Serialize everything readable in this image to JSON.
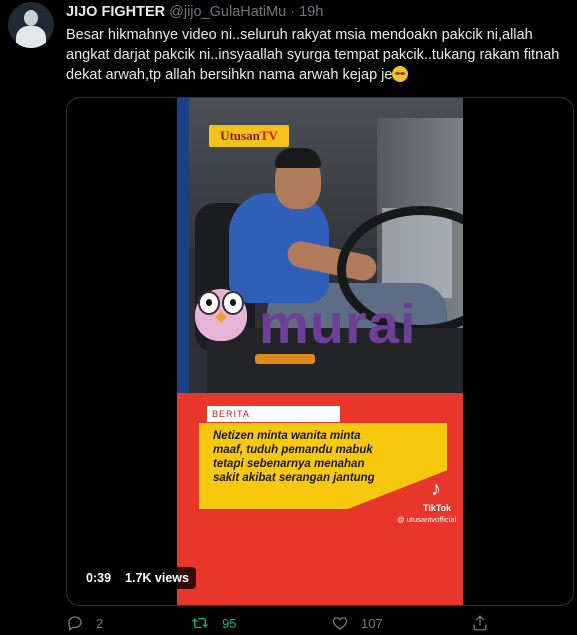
{
  "tweet": {
    "author_name": "JIJO FIGHTER",
    "handle": "@jijo_GulaHatiMu",
    "separator": "·",
    "time": "19h",
    "text": "Besar hikmahnye video ni..seluruh rakyat msia mendoakn pakcik ni,allah angkat darjat pakcik ni..insyaallah syurga tempat pakcik..tukang rakam fitnah dekat arwah,tp allah bersihkn nama arwah kejap je"
  },
  "video": {
    "brand_logo": "Utusan",
    "brand_logo_tv": "TV",
    "watermark": "murai",
    "category": "BERITA",
    "headline": "Netizen minta wanita minta maaf, tuduh pemandu mabuk tetapi sebenarnya menahan sakit akibat serangan jantung",
    "tiktok_icon": "♪",
    "tiktok_label": "TikTok",
    "tiktok_user": "@ utusantvofficial",
    "duration": "0:39",
    "views": "1.7K views"
  },
  "actions": {
    "reply_icon": "reply-icon",
    "reply_count": "2",
    "retweet_icon": "retweet-icon",
    "retweet_count": "95",
    "like_icon": "heart-icon",
    "like_count": "107",
    "share_icon": "share-icon"
  },
  "colors": {
    "background": "#000000",
    "text": "#e7e9ea",
    "muted": "#71767b",
    "retweet_active": "#00ba7c"
  }
}
